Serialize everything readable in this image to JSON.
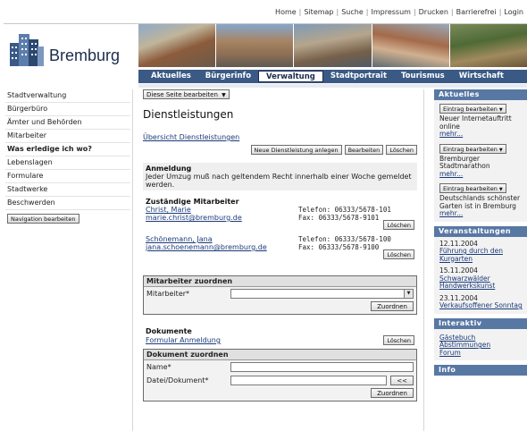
{
  "top_nav": [
    "Home",
    "Sitemap",
    "Suche",
    "Impressum",
    "Drucken",
    "Barrierefrei",
    "Login"
  ],
  "logo": {
    "name": "Bremburg"
  },
  "main_nav": [
    {
      "label": "Aktuelles",
      "active": false
    },
    {
      "label": "Bürgerinfo",
      "active": false
    },
    {
      "label": "Verwaltung",
      "active": true
    },
    {
      "label": "Stadtportrait",
      "active": false
    },
    {
      "label": "Tourismus",
      "active": false
    },
    {
      "label": "Wirtschaft",
      "active": false
    }
  ],
  "sidebar": {
    "items": [
      {
        "label": "Stadtverwaltung",
        "bold": false
      },
      {
        "label": "Bürgerbüro",
        "bold": false
      },
      {
        "label": "Ämter und Behörden",
        "bold": false
      },
      {
        "label": "Mitarbeiter",
        "bold": false
      },
      {
        "label": "Was erledige ich wo?",
        "bold": true
      },
      {
        "label": "Lebenslagen",
        "bold": false
      },
      {
        "label": "Formulare",
        "bold": false
      },
      {
        "label": "Stadtwerke",
        "bold": false
      },
      {
        "label": "Beschwerden",
        "bold": false
      }
    ],
    "nav_edit_button": "Navigation bearbeiten"
  },
  "content": {
    "edit_page_button": "Diese Seite bearbeiten",
    "title": "Dienstleistungen",
    "overview_link": "Übersicht Dienstleistungen",
    "new_service_button": "Neue Dienstleistung anlegen",
    "edit_button": "Bearbeiten",
    "delete_button": "Löschen",
    "registration": {
      "header": "Anmeldung",
      "text": "Jeder Umzug muß nach geltendem Recht innerhalb einer Woche gemeldet werden."
    },
    "staff": {
      "header": "Zuständige Mitarbeiter",
      "people": [
        {
          "name": "Christ, Marie",
          "email": "marie.christ@bremburg.de",
          "phone": "Telefon: 06333/5678-101",
          "fax": "Fax: 06333/5678-9101"
        },
        {
          "name": "Schönemann, Jana",
          "email": "jana.schoenemann@bremburg.de",
          "phone": "Telefon: 06333/5678-100",
          "fax": "Fax: 06333/5678-9100"
        }
      ],
      "delete_label": "Löschen"
    },
    "assign_staff": {
      "header": "Mitarbeiter zuordnen",
      "field_label": "Mitarbeiter*",
      "field_value": "",
      "submit": "Zuordnen"
    },
    "documents": {
      "header": "Dokumente",
      "items": [
        {
          "label": "Formular Anmeldung",
          "delete": "Löschen"
        }
      ]
    },
    "assign_document": {
      "header": "Dokument zuordnen",
      "name_label": "Name*",
      "name_value": "",
      "file_label": "Datei/Dokument*",
      "file_value": "",
      "browse": "<<",
      "submit": "Zuordnen"
    }
  },
  "right": {
    "news": {
      "header": "Aktuelles",
      "edit_label": "Eintrag bearbeiten",
      "items": [
        {
          "text": "Neuer Internetauftritt online",
          "more": "mehr..."
        },
        {
          "text": "Bremburger Stadtmarathon",
          "more": "mehr..."
        },
        {
          "text": "Deutschlands schönster Garten ist in Bremburg",
          "more": "mehr..."
        }
      ]
    },
    "events": {
      "header": "Veranstaltungen",
      "items": [
        {
          "date": "12.11.2004",
          "title": "Führung durch den Kurgarten"
        },
        {
          "date": "15.11.2004",
          "title": "Schwarzwälder Handwerkskunst"
        },
        {
          "date": "23.11.2004",
          "title": "Verkaufsoffener Sonntag"
        }
      ]
    },
    "interactive": {
      "header": "Interaktiv",
      "links": [
        "Gästebuch",
        "Abstimmungen",
        "Forum"
      ]
    },
    "info": {
      "header": "Info"
    }
  },
  "colors": {
    "nav_blue": "#3a5a85",
    "panel_header": "#5878a4",
    "link": "#1a3a7a"
  },
  "icons": {
    "dropdown": "triangle-down-icon",
    "logo": "building-icon"
  }
}
